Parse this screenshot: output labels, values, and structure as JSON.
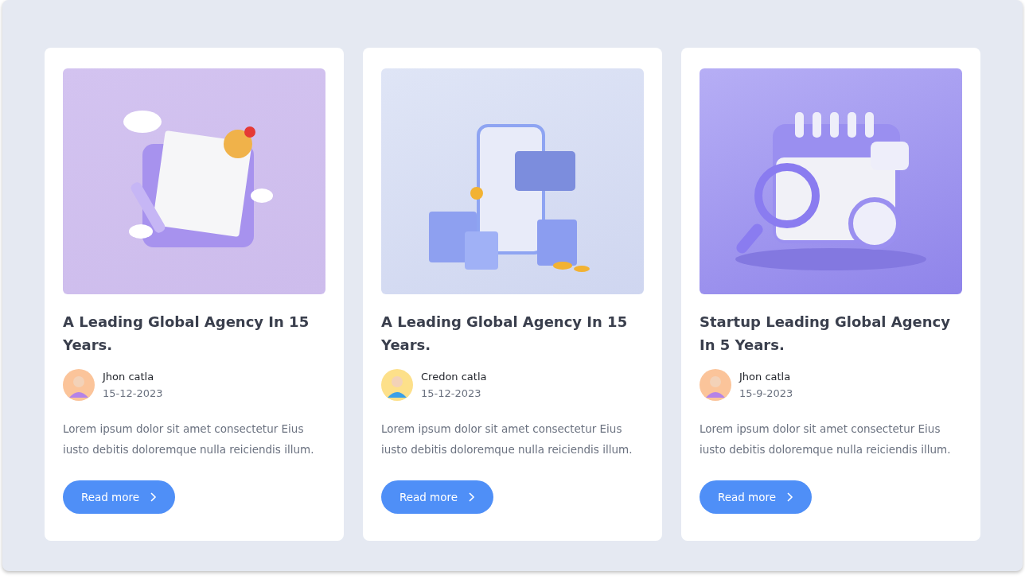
{
  "cards": [
    {
      "image": {
        "kind": "notepad"
      },
      "title": "A Leading Global Agency In 15 Years.",
      "author": "Jhon catla",
      "date": "15-12-2023",
      "excerpt": "Lorem ipsum dolor sit amet consectetur Eius iusto debitis doloremque nulla reiciendis illum.",
      "button": "Read more"
    },
    {
      "image": {
        "kind": "shopping"
      },
      "title": "A Leading Global Agency In 15 Years.",
      "author": "Credon catla",
      "date": "15-12-2023",
      "excerpt": "Lorem ipsum dolor sit amet consectetur Eius iusto debitis doloremque nulla reiciendis illum.",
      "button": "Read more"
    },
    {
      "image": {
        "kind": "calendar"
      },
      "title": "Startup Leading Global Agency In 5 Years.",
      "author": "Jhon catla",
      "date": "15-9-2023",
      "excerpt": "Lorem ipsum dolor sit amet consectetur Eius iusto debitis doloremque nulla reiciendis illum.",
      "button": "Read more"
    }
  ]
}
